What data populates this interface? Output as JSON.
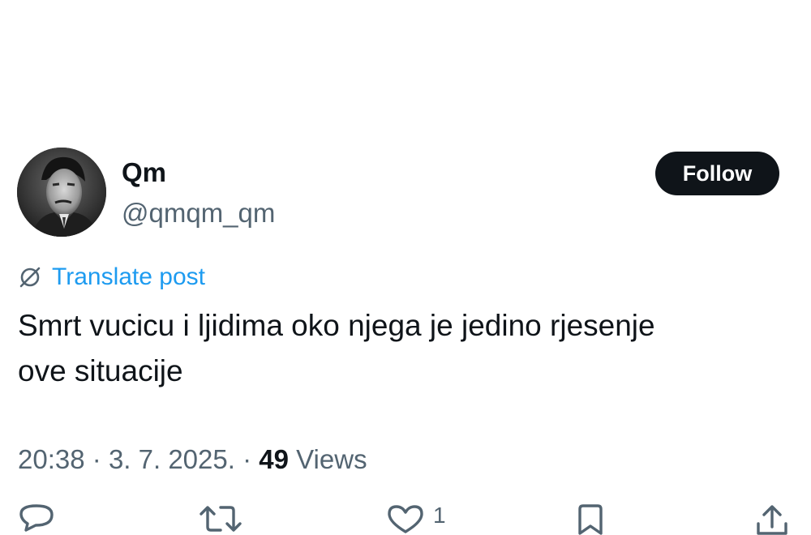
{
  "author": {
    "display_name": "Qm",
    "handle": "@qmqm_qm"
  },
  "follow_button": {
    "label": "Follow"
  },
  "translate": {
    "label": "Translate post"
  },
  "post": {
    "text": "Smrt vucicu i ljidima oko njega je jedino rjesenje\nove situacije"
  },
  "meta": {
    "time": "20:38",
    "separator": "·",
    "date": "3. 7. 2025.",
    "views_count": "49",
    "views_label": "Views"
  },
  "actions": {
    "like_count": "1"
  },
  "icons": {
    "translate": "globe-slash-icon",
    "reply": "reply-icon",
    "repost": "repost-icon",
    "like": "heart-icon",
    "bookmark": "bookmark-icon",
    "share": "share-icon"
  },
  "colors": {
    "link_blue": "#1d9bf0",
    "text_primary": "#0f1419",
    "text_secondary": "#536471",
    "button_bg": "#0f1419"
  }
}
